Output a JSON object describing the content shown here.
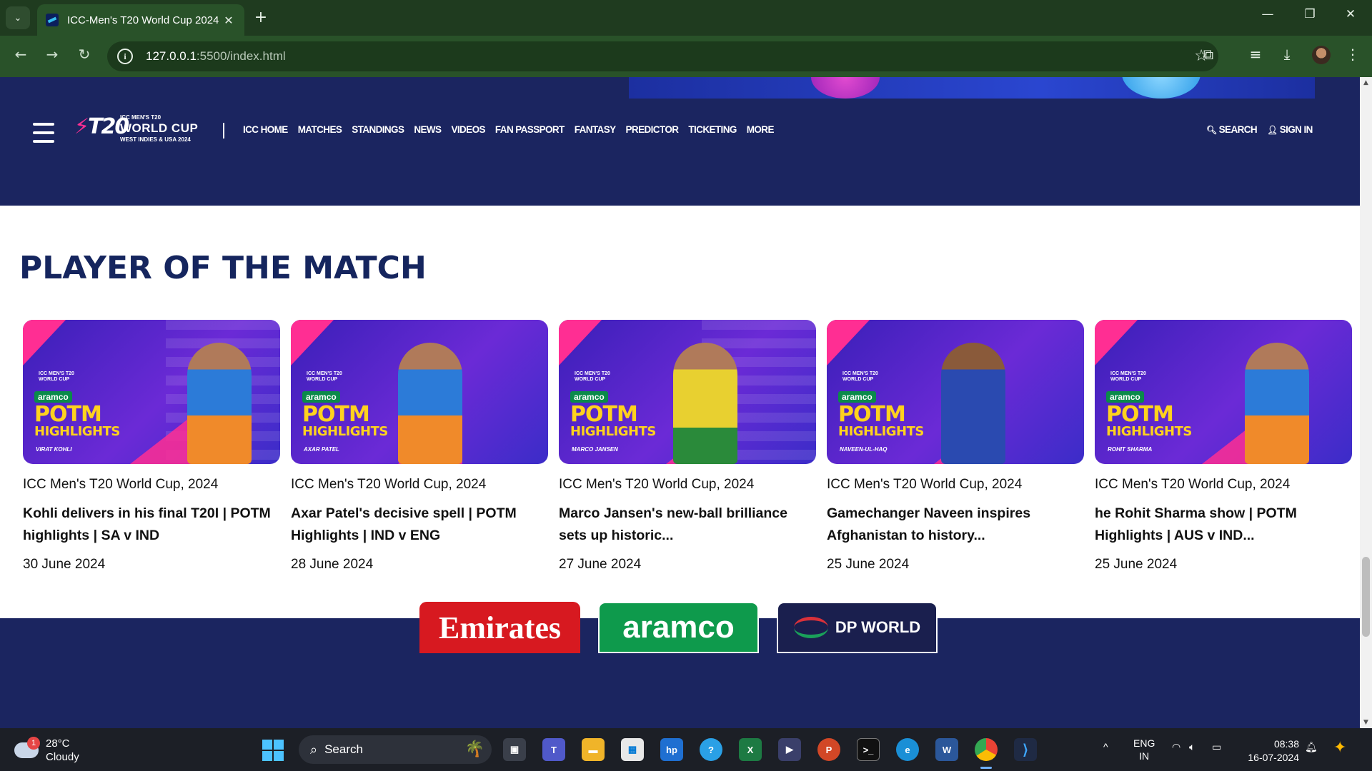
{
  "browser": {
    "tab_title": "ICC-Men's T20 World Cup 2024",
    "url_host": "127.0.0.1",
    "url_rest": ":5500/index.html"
  },
  "site": {
    "logo": {
      "small": "ICC MEN'S T20",
      "big": "WORLD CUP",
      "sub": "WEST INDIES & USA 2024"
    },
    "nav": [
      "ICC HOME",
      "MATCHES",
      "STANDINGS",
      "NEWS",
      "VIDEOS",
      "FAN PASSPORT",
      "FANTASY",
      "PREDICTOR",
      "TICKETING",
      "MORE"
    ],
    "search_label": "SEARCH",
    "signin_label": "SIGN IN"
  },
  "section": {
    "title": "PLAYER OF THE MATCH",
    "cards": [
      {
        "category": "ICC Men's T20 World Cup, 2024",
        "headline": "Kohli delivers in his final T20I | POTM highlights | SA v IND",
        "date": "30 June 2024",
        "thumb_player": "VIRAT KOHLI"
      },
      {
        "category": "ICC Men's T20 World Cup, 2024",
        "headline": "Axar Patel's decisive spell | POTM Highlights | IND v ENG",
        "date": "28 June 2024",
        "thumb_player": "AXAR PATEL"
      },
      {
        "category": "ICC Men's T20 World Cup, 2024",
        "headline": "Marco Jansen's new-ball brilliance sets up historic...",
        "date": "27 June 2024",
        "thumb_player": "MARCO JANSEN"
      },
      {
        "category": "ICC Men's T20 World Cup, 2024",
        "headline": "Gamechanger Naveen inspires Afghanistan to history...",
        "date": "25 June 2024",
        "thumb_player": "NAVEEN-UL-HAQ"
      },
      {
        "category": "ICC Men's T20 World Cup, 2024",
        "headline": "he Rohit Sharma show | POTM Highlights | AUS v IND...",
        "date": "25 June 2024",
        "thumb_player": "ROHIT SHARMA"
      }
    ],
    "thumb_text": {
      "sponsor": "aramco",
      "potm": "POTM",
      "highlights": "HIGHLIGHTS",
      "mini_logo_1": "ICC MEN'S T20",
      "mini_logo_2": "WORLD CUP"
    }
  },
  "sponsors": [
    "Emirates",
    "aramco",
    "DP WORLD"
  ],
  "taskbar": {
    "temperature": "28°C",
    "weather": "Cloudy",
    "weather_badge": "1",
    "search_label": "Search",
    "lang_1": "ENG",
    "lang_2": "IN",
    "time": "08:38",
    "date": "16-07-2024"
  },
  "colors": {
    "header_bg": "#1b2560",
    "title_color": "#15255e",
    "accent_pink": "#ff2e93",
    "potm_yellow": "#ffd21e"
  }
}
